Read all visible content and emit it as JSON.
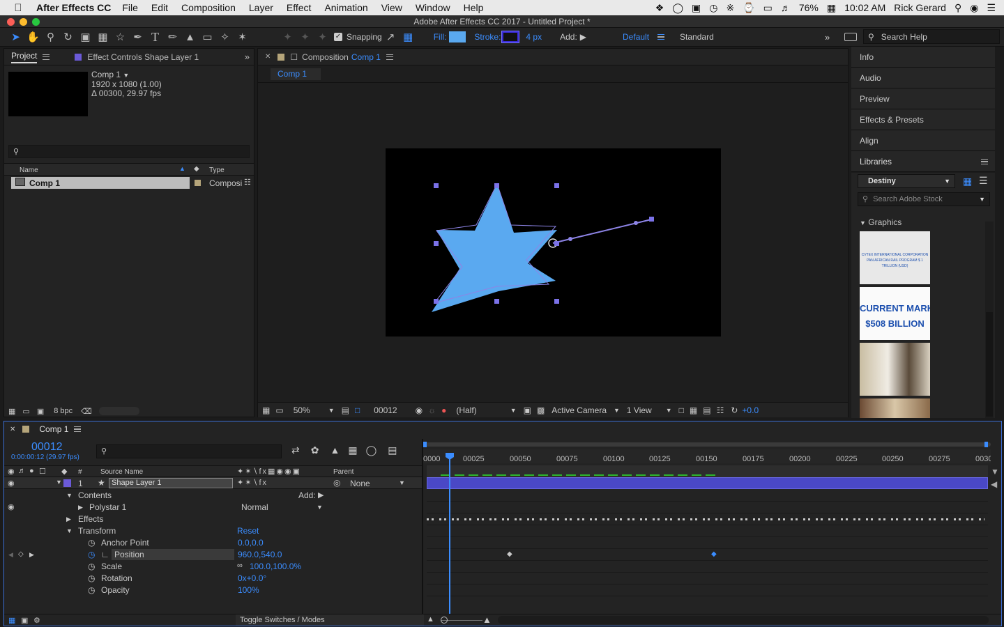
{
  "menubar": {
    "app": "After Effects CC",
    "items": [
      "File",
      "Edit",
      "Composition",
      "Layer",
      "Effect",
      "Animation",
      "View",
      "Window",
      "Help"
    ],
    "battery": "76%",
    "time": "10:02 AM",
    "user": "Rick Gerard"
  },
  "window": {
    "title": "Adobe After Effects CC 2017 - Untitled Project *"
  },
  "toolbar": {
    "snapping": "Snapping",
    "fill_label": "Fill:",
    "stroke_label": "Stroke:",
    "stroke_width": "4 px",
    "add_label": "Add:",
    "workspace_default": "Default",
    "workspace_standard": "Standard",
    "search_help": "Search Help",
    "fill_color": "#5aa9f0",
    "stroke_color": "#3a2bd8"
  },
  "project": {
    "tab_project": "Project",
    "tab_effects": "Effect Controls Shape Layer 1",
    "comp_name": "Comp 1",
    "comp_res": "1920 x 1080 (1.00)",
    "comp_dur": "Δ 00300, 29.97 fps",
    "col_name": "Name",
    "col_type": "Type",
    "item_name": "Comp 1",
    "item_type": "Composi",
    "bpc": "8 bpc"
  },
  "composition": {
    "tab_label": "Composition",
    "tab_comp": "Comp 1",
    "sub_tab": "Comp 1",
    "zoom": "50%",
    "timecode": "00012",
    "resolution": "(Half)",
    "camera": "Active Camera",
    "views": "1 View",
    "exposure": "+0.0"
  },
  "right_panel": {
    "items": [
      "Info",
      "Audio",
      "Preview",
      "Effects & Presets",
      "Align"
    ],
    "libraries": "Libraries",
    "library_select": "Destiny",
    "stock_search": "Search Adobe Stock",
    "graphics": "Graphics",
    "thumb1_line1": "CVTEX INTERNATIONAL CORPORATION",
    "thumb1_line2": "PAN AFRICAN RAIL PROGRAM $ 1 TRILLION (USD)",
    "thumb2_line1": "CURRENT MARKET",
    "thumb2_line2": "$508 BILLION"
  },
  "timeline": {
    "tab": "Comp 1",
    "timecode": "00012",
    "timecode_sub": "0:00:00:12 (29.97 fps)",
    "col_hash": "#",
    "col_source": "Source Name",
    "col_parent": "Parent",
    "layer_num": "1",
    "layer_name": "Shape Layer 1",
    "parent_value": "None",
    "contents": "Contents",
    "add": "Add:",
    "polystar": "Polystar 1",
    "blend": "Normal",
    "effects": "Effects",
    "transform": "Transform",
    "reset": "Reset",
    "props": [
      {
        "name": "Anchor Point",
        "value": "0.0,0.0"
      },
      {
        "name": "Position",
        "value": "960.0,540.0"
      },
      {
        "name": "Scale",
        "value": "100.0,100.0%"
      },
      {
        "name": "Rotation",
        "value": "0x+0.0°"
      },
      {
        "name": "Opacity",
        "value": "100%"
      }
    ],
    "toggle": "Toggle Switches / Modes",
    "ruler": [
      "0000",
      "00025",
      "00050",
      "00075",
      "00100",
      "00125",
      "00150",
      "00175",
      "00200",
      "00225",
      "00250",
      "00275",
      "0030"
    ]
  }
}
